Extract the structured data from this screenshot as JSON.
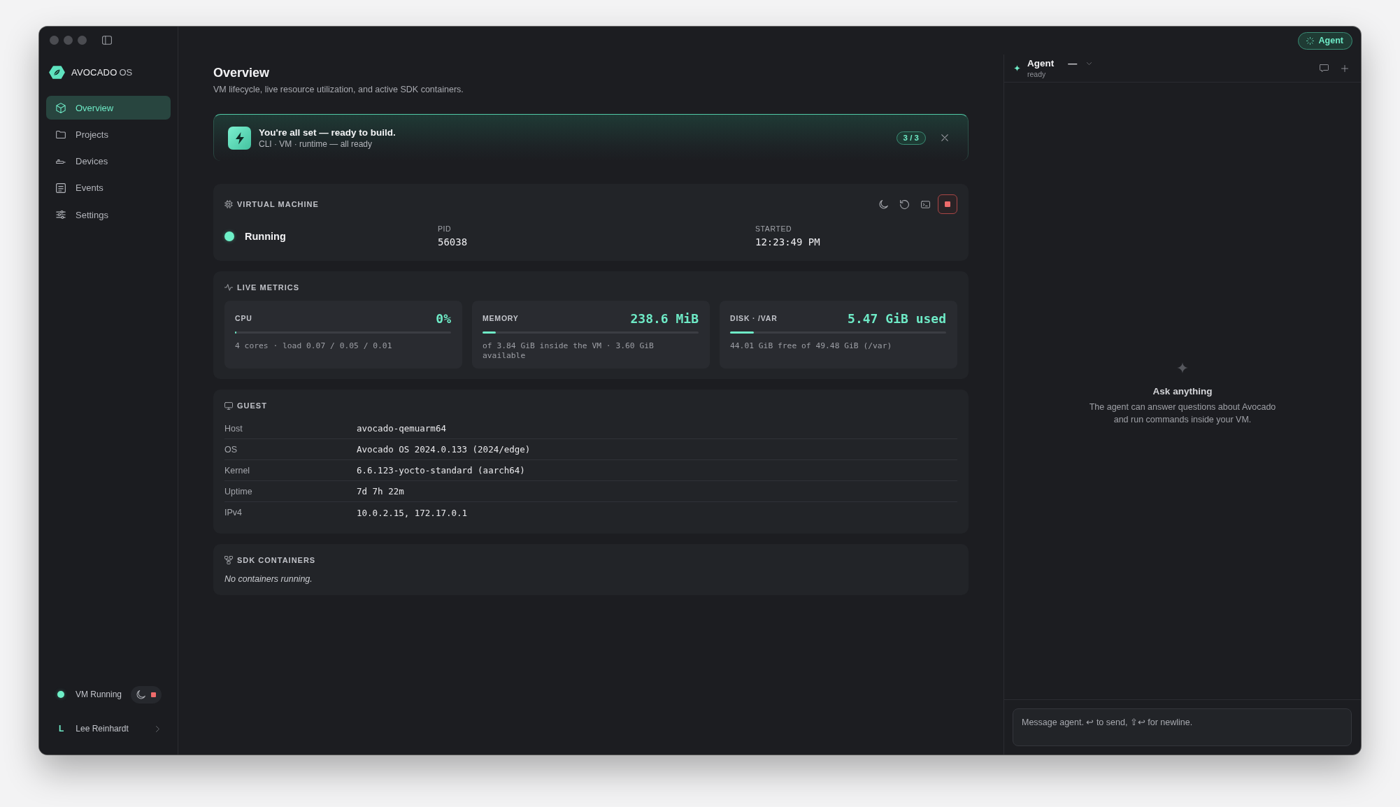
{
  "titlebar": {
    "agent_button": {
      "label": "Agent",
      "active": true
    }
  },
  "sidebar": {
    "brand": {
      "name": "AVOCADO",
      "suffix": "OS"
    },
    "nav": [
      {
        "label": "Overview",
        "selected": true
      },
      {
        "label": "Projects",
        "selected": false
      },
      {
        "label": "Devices",
        "selected": false
      },
      {
        "label": "Events",
        "selected": false
      },
      {
        "label": "Settings",
        "selected": false
      }
    ],
    "vm_status": {
      "label": "VM Running",
      "running": true
    },
    "user": {
      "initial": "L",
      "name": "Lee Reinhardt"
    }
  },
  "page": {
    "title": "Overview",
    "subtitle": "VM lifecycle, live resource utilization, and active SDK containers."
  },
  "banner": {
    "title": "You're all set — ready to build.",
    "subtitle": "CLI · VM · runtime — all ready",
    "progress": "3 / 3"
  },
  "virtual_machine": {
    "title": "VIRTUAL MACHINE",
    "status": {
      "label": "Running",
      "running": true
    },
    "fields": [
      {
        "label": "PID",
        "value": "56038"
      },
      {
        "label": "STARTED",
        "value": "12:23:49 PM"
      }
    ]
  },
  "live_metrics": {
    "title": "LIVE METRICS",
    "tiles": [
      {
        "label": "CPU",
        "value": "0%",
        "level": 0,
        "detail": "4 cores · load 0.07 / 0.05 / 0.01"
      },
      {
        "label": "MEMORY",
        "value": "238.6 MiB",
        "level": 0.06,
        "detail": "of 3.84 GiB inside the VM · 3.60 GiB available"
      },
      {
        "label": "DISK · /VAR",
        "value": "5.47 GiB used",
        "level": 0.11,
        "detail": "44.01 GiB free of 49.48 GiB (/var)"
      }
    ]
  },
  "guest": {
    "title": "GUEST",
    "rows": [
      {
        "key": "Host",
        "value": "avocado-qemuarm64"
      },
      {
        "key": "OS",
        "value": "Avocado OS 2024.0.133 (2024/edge)"
      },
      {
        "key": "Kernel",
        "value": "6.6.123-yocto-standard (aarch64)"
      },
      {
        "key": "Uptime",
        "value": "7d 7h 22m"
      },
      {
        "key": "IPv4",
        "value": "10.0.2.15, 172.17.0.1"
      }
    ]
  },
  "sdk_containers": {
    "title": "SDK CONTAINERS",
    "empty_text": "No containers running."
  },
  "agent": {
    "title": "Agent",
    "status": "ready",
    "model": "—",
    "empty_state": {
      "title": "Ask anything",
      "text": "The agent can answer questions about Avocado and run commands inside your VM."
    },
    "composer": {
      "placeholder": "Message agent. ↩ to send, ⇧↩ for newline."
    }
  }
}
